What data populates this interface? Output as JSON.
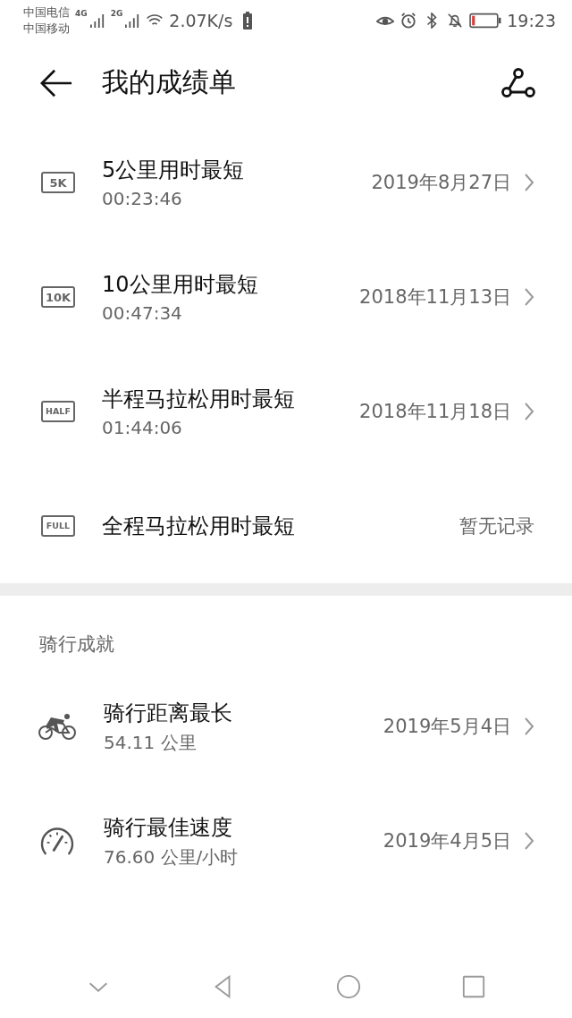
{
  "status_bar": {
    "carriers": [
      "中国电信",
      "中国移动"
    ],
    "network_types": [
      "4G",
      "2G"
    ],
    "speed": "2.07K/s",
    "time": "19:23"
  },
  "header": {
    "title": "我的成绩单"
  },
  "running_records": [
    {
      "kind": "record",
      "icon": {
        "kind": "badge",
        "text": "5K"
      },
      "title": "5公里用时最短",
      "value": "00:23:46",
      "date": "2019年8月27日"
    },
    {
      "kind": "record",
      "icon": {
        "kind": "badge",
        "text": "10K"
      },
      "title": "10公里用时最短",
      "value": "00:47:34",
      "date": "2018年11月13日"
    },
    {
      "kind": "record",
      "icon": {
        "kind": "badge",
        "text": "HALF"
      },
      "title": "半程马拉松用时最短",
      "value": "01:44:06",
      "date": "2018年11月18日"
    },
    {
      "kind": "empty",
      "icon": {
        "kind": "badge",
        "text": "FULL"
      },
      "title": "全程马拉松用时最短",
      "note": "暂无记录"
    }
  ],
  "cycling_section": {
    "title": "骑行成就",
    "records": [
      {
        "kind": "record",
        "icon": {
          "kind": "cycling"
        },
        "title": "骑行距离最长",
        "value": "54.11 公里",
        "date": "2019年5月4日"
      },
      {
        "kind": "record",
        "icon": {
          "kind": "speedometer"
        },
        "title": "骑行最佳速度",
        "value": "76.60  公里/小时",
        "date": "2019年4月5日"
      }
    ]
  }
}
